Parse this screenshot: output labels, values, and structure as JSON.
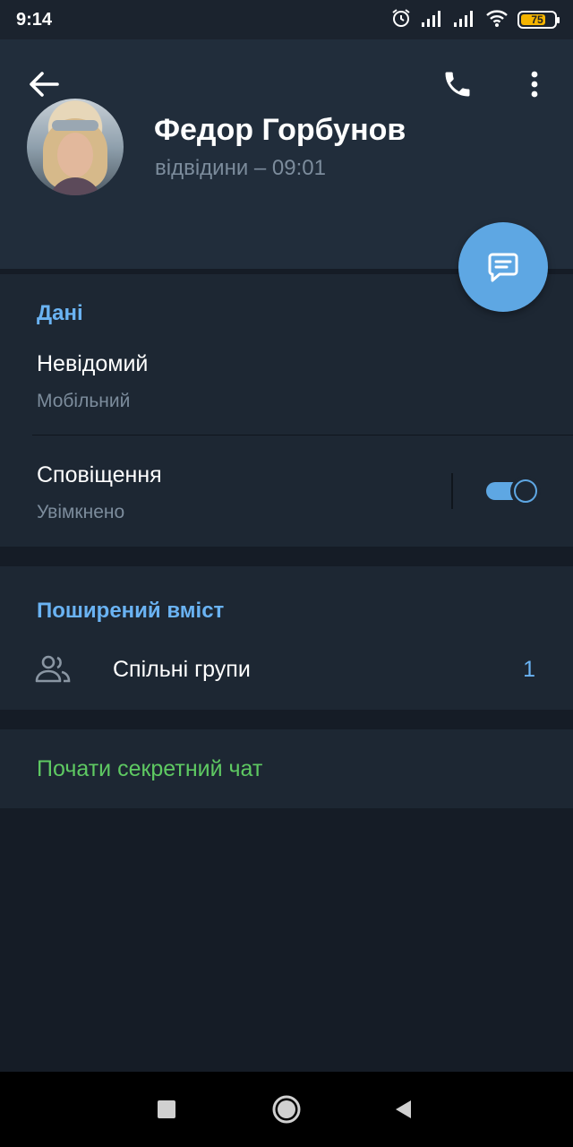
{
  "status_bar": {
    "time": "9:14",
    "battery": "75",
    "battery_fraction": 0.75,
    "icons": [
      "alarm-icon",
      "signal-icon",
      "signal-icon",
      "wifi-icon",
      "battery-icon"
    ]
  },
  "header": {
    "back_icon": "arrow-left-icon",
    "call_icon": "phone-icon",
    "more_icon": "more-vertical-icon",
    "name": "Федор Горбунов",
    "status": "відвідини – 09:01",
    "fab_icon": "message-icon"
  },
  "info": {
    "title": "Дані",
    "phone_value": "Невідомий",
    "phone_label": "Мобільний",
    "notifications_title": "Сповіщення",
    "notifications_state": "Увімкнено",
    "notifications_on": true
  },
  "shared": {
    "title": "Поширений вміст",
    "groups_icon": "groups-icon",
    "groups_label": "Спільні групи",
    "groups_count": "1"
  },
  "secret": {
    "label": "Почати секретний чат"
  },
  "navbar": {
    "icons": [
      "recents-icon",
      "home-icon",
      "back-triangle-icon"
    ]
  },
  "colors": {
    "accent": "#5ea7e3",
    "section_title": "#6ab3f3",
    "secret_green": "#5ec962",
    "header_bg": "#212d3b",
    "section_bg": "#1d2733",
    "page_bg": "#151c26"
  }
}
